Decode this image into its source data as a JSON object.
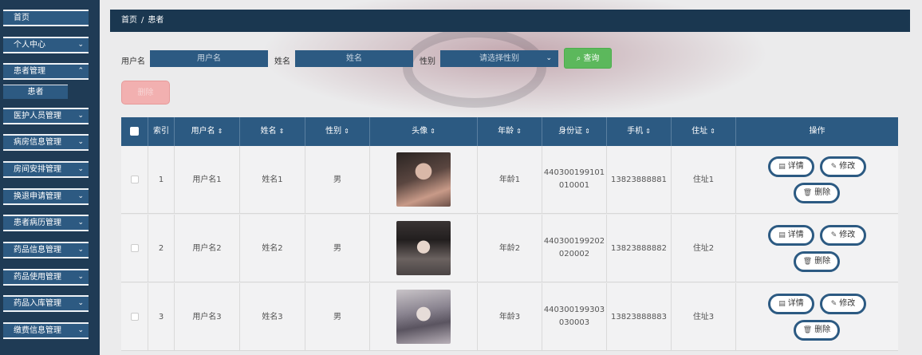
{
  "sidebar": {
    "items": [
      {
        "label": "首页",
        "chevron": false
      },
      {
        "label": "个人中心",
        "chevron": true
      },
      {
        "label": "患者管理",
        "chevron": true
      },
      {
        "label": "医护人员管理",
        "chevron": true
      },
      {
        "label": "病房信息管理",
        "chevron": true
      },
      {
        "label": "房间安排管理",
        "chevron": true
      },
      {
        "label": "换退申请管理",
        "chevron": true
      },
      {
        "label": "患者病历管理",
        "chevron": true
      },
      {
        "label": "药品信息管理",
        "chevron": true
      },
      {
        "label": "药品使用管理",
        "chevron": true
      },
      {
        "label": "药品入库管理",
        "chevron": true
      },
      {
        "label": "缴费信息管理",
        "chevron": true
      }
    ],
    "submenu": {
      "label": "患者"
    }
  },
  "breadcrumb": {
    "home": "首页",
    "separator": "/",
    "current": "患者"
  },
  "search": {
    "username_label": "用户名",
    "username_placeholder": "用户名",
    "name_label": "姓名",
    "name_placeholder": "姓名",
    "gender_label": "性别",
    "gender_placeholder": "请选择性别",
    "query_label": "查询"
  },
  "toolbar": {
    "delete_label": "删除"
  },
  "table": {
    "headers": {
      "index": "索引",
      "username": "用户名",
      "name": "姓名",
      "gender": "性别",
      "avatar": "头像",
      "age": "年龄",
      "id_card": "身份证",
      "phone": "手机",
      "address": "住址",
      "actions": "操作"
    },
    "rows": [
      {
        "index": "1",
        "username": "用户名1",
        "name": "姓名1",
        "gender": "男",
        "age": "年龄1",
        "id_line1": "440300199101",
        "id_line2": "010001",
        "phone": "13823888881",
        "address": "住址1"
      },
      {
        "index": "2",
        "username": "用户名2",
        "name": "姓名2",
        "gender": "男",
        "age": "年龄2",
        "id_line1": "440300199202",
        "id_line2": "020002",
        "phone": "13823888882",
        "address": "住址2"
      },
      {
        "index": "3",
        "username": "用户名3",
        "name": "姓名3",
        "gender": "男",
        "age": "年龄3",
        "id_line1": "440300199303",
        "id_line2": "030003",
        "phone": "13823888883",
        "address": "住址3"
      }
    ],
    "actions": {
      "detail": "详情",
      "edit": "修改",
      "delete": "删除"
    }
  },
  "colors": {
    "sidebar_bg": "#1f3b55",
    "primary": "#2c5a82",
    "success": "#5cb85c",
    "danger_disabled": "#f2b0b0"
  }
}
